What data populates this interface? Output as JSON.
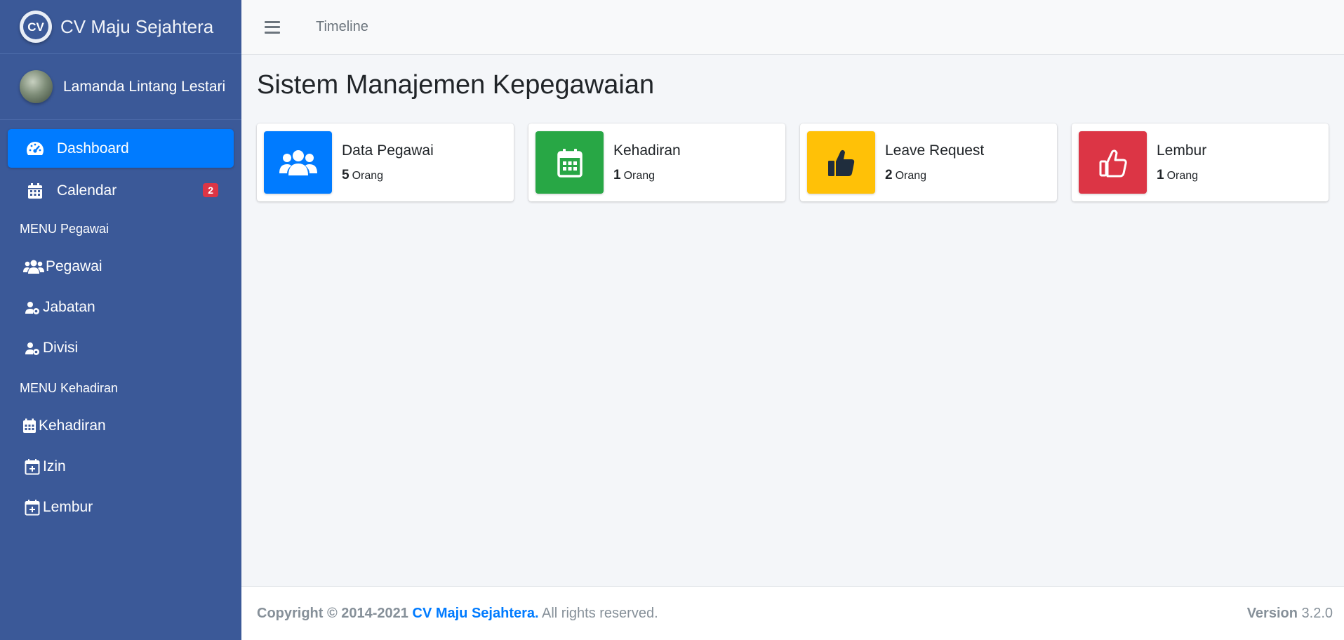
{
  "brand": {
    "name": "CV Maju Sejahtera"
  },
  "user": {
    "name": "Lamanda Lintang Lestari"
  },
  "sidebar": {
    "dashboard": "Dashboard",
    "calendar": "Calendar",
    "calendar_badge": "2",
    "header_pegawai": "MENU Pegawai",
    "pegawai": "Pegawai",
    "jabatan": "Jabatan",
    "divisi": "Divisi",
    "header_kehadiran": "MENU Kehadiran",
    "kehadiran": "Kehadiran",
    "izin": "Izin",
    "lembur": "Lembur"
  },
  "topbar": {
    "link": "Timeline"
  },
  "page": {
    "title": "Sistem Manajemen Kepegawaian"
  },
  "cards": [
    {
      "label": "Data Pegawai",
      "count": "5",
      "unit": "Orang",
      "color": "#007bff",
      "icon": "users-icon"
    },
    {
      "label": "Kehadiran",
      "count": "1",
      "unit": "Orang",
      "color": "#28a745",
      "icon": "calendar-icon"
    },
    {
      "label": "Leave Request",
      "count": "2",
      "unit": "Orang",
      "color": "#ffc107",
      "icon": "thumbs-up-icon"
    },
    {
      "label": "Lembur",
      "count": "1",
      "unit": "Orang",
      "color": "#dc3545",
      "icon": "thumbs-up-outline-icon"
    }
  ],
  "footer": {
    "copyright": "Copyright © 2014-2021",
    "company": "CV Maju Sejahtera.",
    "rights": "All rights reserved.",
    "version_label": "Version",
    "version": "3.2.0"
  }
}
